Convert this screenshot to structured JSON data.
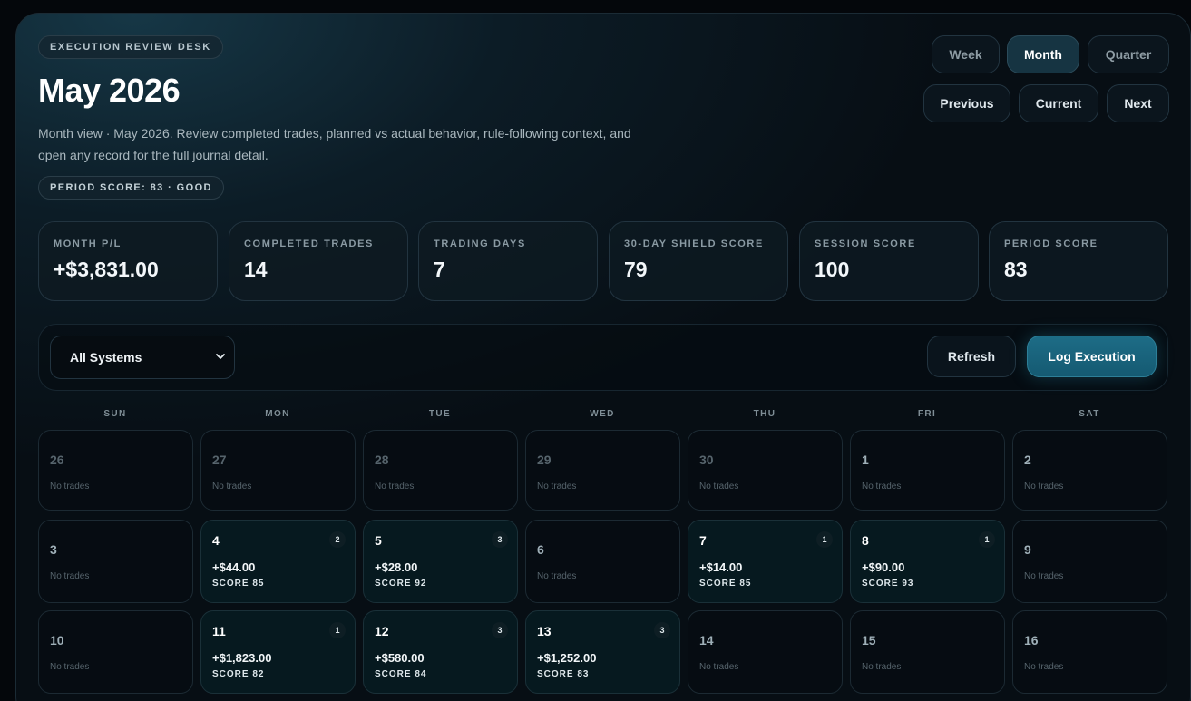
{
  "header": {
    "kicker": "EXECUTION REVIEW DESK",
    "title": "May 2026",
    "description": "Month view · May 2026. Review completed trades, planned vs actual behavior, rule-following context, and open any record for the full journal detail.",
    "period_badge": "PERIOD SCORE: 83 · GOOD"
  },
  "view_toggle": {
    "week": "Week",
    "month": "Month",
    "quarter": "Quarter",
    "selected": "Month"
  },
  "nav": {
    "previous": "Previous",
    "current": "Current",
    "next": "Next"
  },
  "stats": [
    {
      "label": "MONTH P/L",
      "value": "+$3,831.00"
    },
    {
      "label": "COMPLETED TRADES",
      "value": "14"
    },
    {
      "label": "TRADING DAYS",
      "value": "7"
    },
    {
      "label": "30-DAY SHIELD SCORE",
      "value": "79"
    },
    {
      "label": "SESSION SCORE",
      "value": "100"
    },
    {
      "label": "PERIOD SCORE",
      "value": "83"
    }
  ],
  "toolbar": {
    "system_filter": "All Systems",
    "refresh": "Refresh",
    "log_execution": "Log Execution"
  },
  "calendar": {
    "weekdays": [
      "SUN",
      "MON",
      "TUE",
      "WED",
      "THU",
      "FRI",
      "SAT"
    ],
    "weeks": [
      [
        {
          "day": "26",
          "other_month": true,
          "text": "No trades"
        },
        {
          "day": "27",
          "other_month": true,
          "text": "No trades"
        },
        {
          "day": "28",
          "other_month": true,
          "text": "No trades"
        },
        {
          "day": "29",
          "other_month": true,
          "text": "No trades"
        },
        {
          "day": "30",
          "other_month": true,
          "text": "No trades"
        },
        {
          "day": "1",
          "text": "No trades"
        },
        {
          "day": "2",
          "text": "No trades"
        }
      ],
      [
        {
          "day": "3",
          "text": "No trades"
        },
        {
          "day": "4",
          "count": "2",
          "pnl": "+$44.00",
          "score": "SCORE 85"
        },
        {
          "day": "5",
          "count": "3",
          "pnl": "+$28.00",
          "score": "SCORE 92"
        },
        {
          "day": "6",
          "text": "No trades"
        },
        {
          "day": "7",
          "count": "1",
          "pnl": "+$14.00",
          "score": "SCORE 85"
        },
        {
          "day": "8",
          "count": "1",
          "pnl": "+$90.00",
          "score": "SCORE 93"
        },
        {
          "day": "9",
          "text": "No trades"
        }
      ],
      [
        {
          "day": "10",
          "text": "No trades"
        },
        {
          "day": "11",
          "count": "1",
          "pnl": "+$1,823.00",
          "score": "SCORE 82"
        },
        {
          "day": "12",
          "count": "3",
          "pnl": "+$580.00",
          "score": "SCORE 84"
        },
        {
          "day": "13",
          "count": "3",
          "pnl": "+$1,252.00",
          "score": "SCORE 83"
        },
        {
          "day": "14",
          "text": "No trades"
        },
        {
          "day": "15",
          "text": "No trades"
        },
        {
          "day": "16",
          "text": "No trades"
        }
      ]
    ]
  }
}
